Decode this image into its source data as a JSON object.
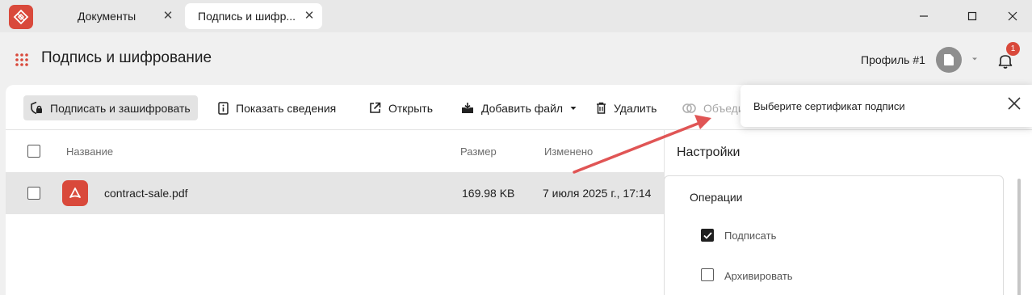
{
  "tabs": [
    {
      "label": "Документы",
      "active": false
    },
    {
      "label": "Подпись и шифр...",
      "active": true
    }
  ],
  "header": {
    "title": "Подпись и шифрование",
    "profile_label": "Профиль #1",
    "notification_count": "1"
  },
  "toolbar": {
    "sign_encrypt": "Подписать и зашифровать",
    "show_info": "Показать сведения",
    "open": "Открыть",
    "add_file": "Добавить файл",
    "delete": "Удалить",
    "merge": "Объеди"
  },
  "table": {
    "columns": {
      "name": "Название",
      "size": "Размер",
      "modified": "Изменено"
    },
    "rows": [
      {
        "name": "contract-sale.pdf",
        "size": "169.98 KB",
        "modified": "7 июля 2025 г., 17:14"
      }
    ]
  },
  "settings": {
    "title": "Настройки",
    "operations_title": "Операции",
    "options": [
      {
        "label": "Подписать",
        "checked": true
      },
      {
        "label": "Архивировать",
        "checked": false
      }
    ]
  },
  "tooltip": {
    "text": "Выберите сертификат подписи"
  },
  "colors": {
    "accent": "#d9493b",
    "annotation_arrow": "#e05555"
  }
}
